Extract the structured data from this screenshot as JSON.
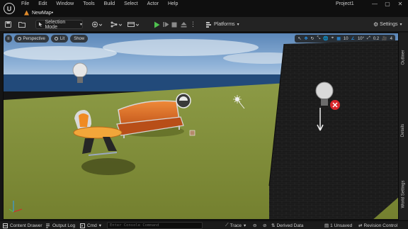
{
  "menubar": {
    "items": [
      "File",
      "Edit",
      "Window",
      "Tools",
      "Build",
      "Select",
      "Actor",
      "Help"
    ],
    "project_name": "Project1",
    "window_buttons": [
      "—",
      "▢",
      "✕"
    ]
  },
  "document_tab": {
    "label": "NewMap•"
  },
  "toolbar": {
    "selection_mode": "Selection Mode",
    "platforms": "Platforms",
    "settings": "Settings"
  },
  "viewport": {
    "perspective": "Perspective",
    "lit": "Lit",
    "show": "Show",
    "grid_snap": "10",
    "rotation_snap": "10°",
    "scale_snap": "0.2",
    "camera_speed": "4"
  },
  "side_tabs": [
    "Outliner",
    "Details",
    "World Settings"
  ],
  "statusbar": {
    "content_drawer": "Content Drawer",
    "output_log": "Output Log",
    "cmd": "Cmd",
    "console_placeholder": "Enter Console Command",
    "trace": "Trace",
    "derived_data": "Derived Data",
    "unsaved": "1 Unsaved",
    "revision_control": "Revision Control"
  },
  "colors": {
    "accent_blue": "#2aa0ff",
    "play_green": "#4fc14f",
    "level_orange": "#e08a2a",
    "error_red": "#d8262b"
  }
}
